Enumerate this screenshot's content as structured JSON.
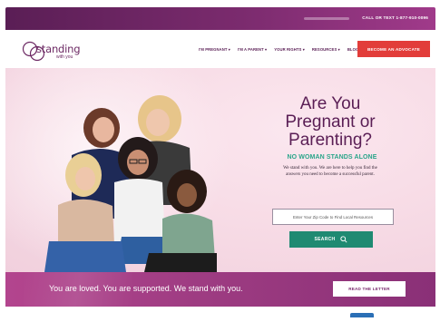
{
  "topbar": {
    "call_text": "CALL OR TEXT 1-877-910-0096"
  },
  "logo": {
    "name": "standing",
    "sub": "with you"
  },
  "nav": {
    "items": [
      "I'M PREGNANT ▾",
      "I'M A PARENT ▾",
      "YOUR RIGHTS ▾",
      "RESOURCES ▾",
      "BLOG"
    ],
    "cta_label": "BECOME AN ADVOCATE"
  },
  "hero": {
    "headline_lines": [
      "Are You",
      "Pregnant or",
      "Parenting?"
    ],
    "tagline": "NO WOMAN STANDS ALONE",
    "description": "We stand with you. We are here to help you find the answers you need to become a successful parent.",
    "zip_placeholder": "Enter Your Zip Code to Find Local Resources",
    "search_label": "SEARCH"
  },
  "banner": {
    "text": "You are loved. You are supported. We stand with you.",
    "button_label": "READ THE LETTER"
  },
  "colors": {
    "brand_purple": "#5a1e55",
    "cta_red": "#e23d3a",
    "teal": "#1f8a72",
    "tagline_green": "#2aa58a",
    "banner_magenta": "#a03a8a"
  }
}
